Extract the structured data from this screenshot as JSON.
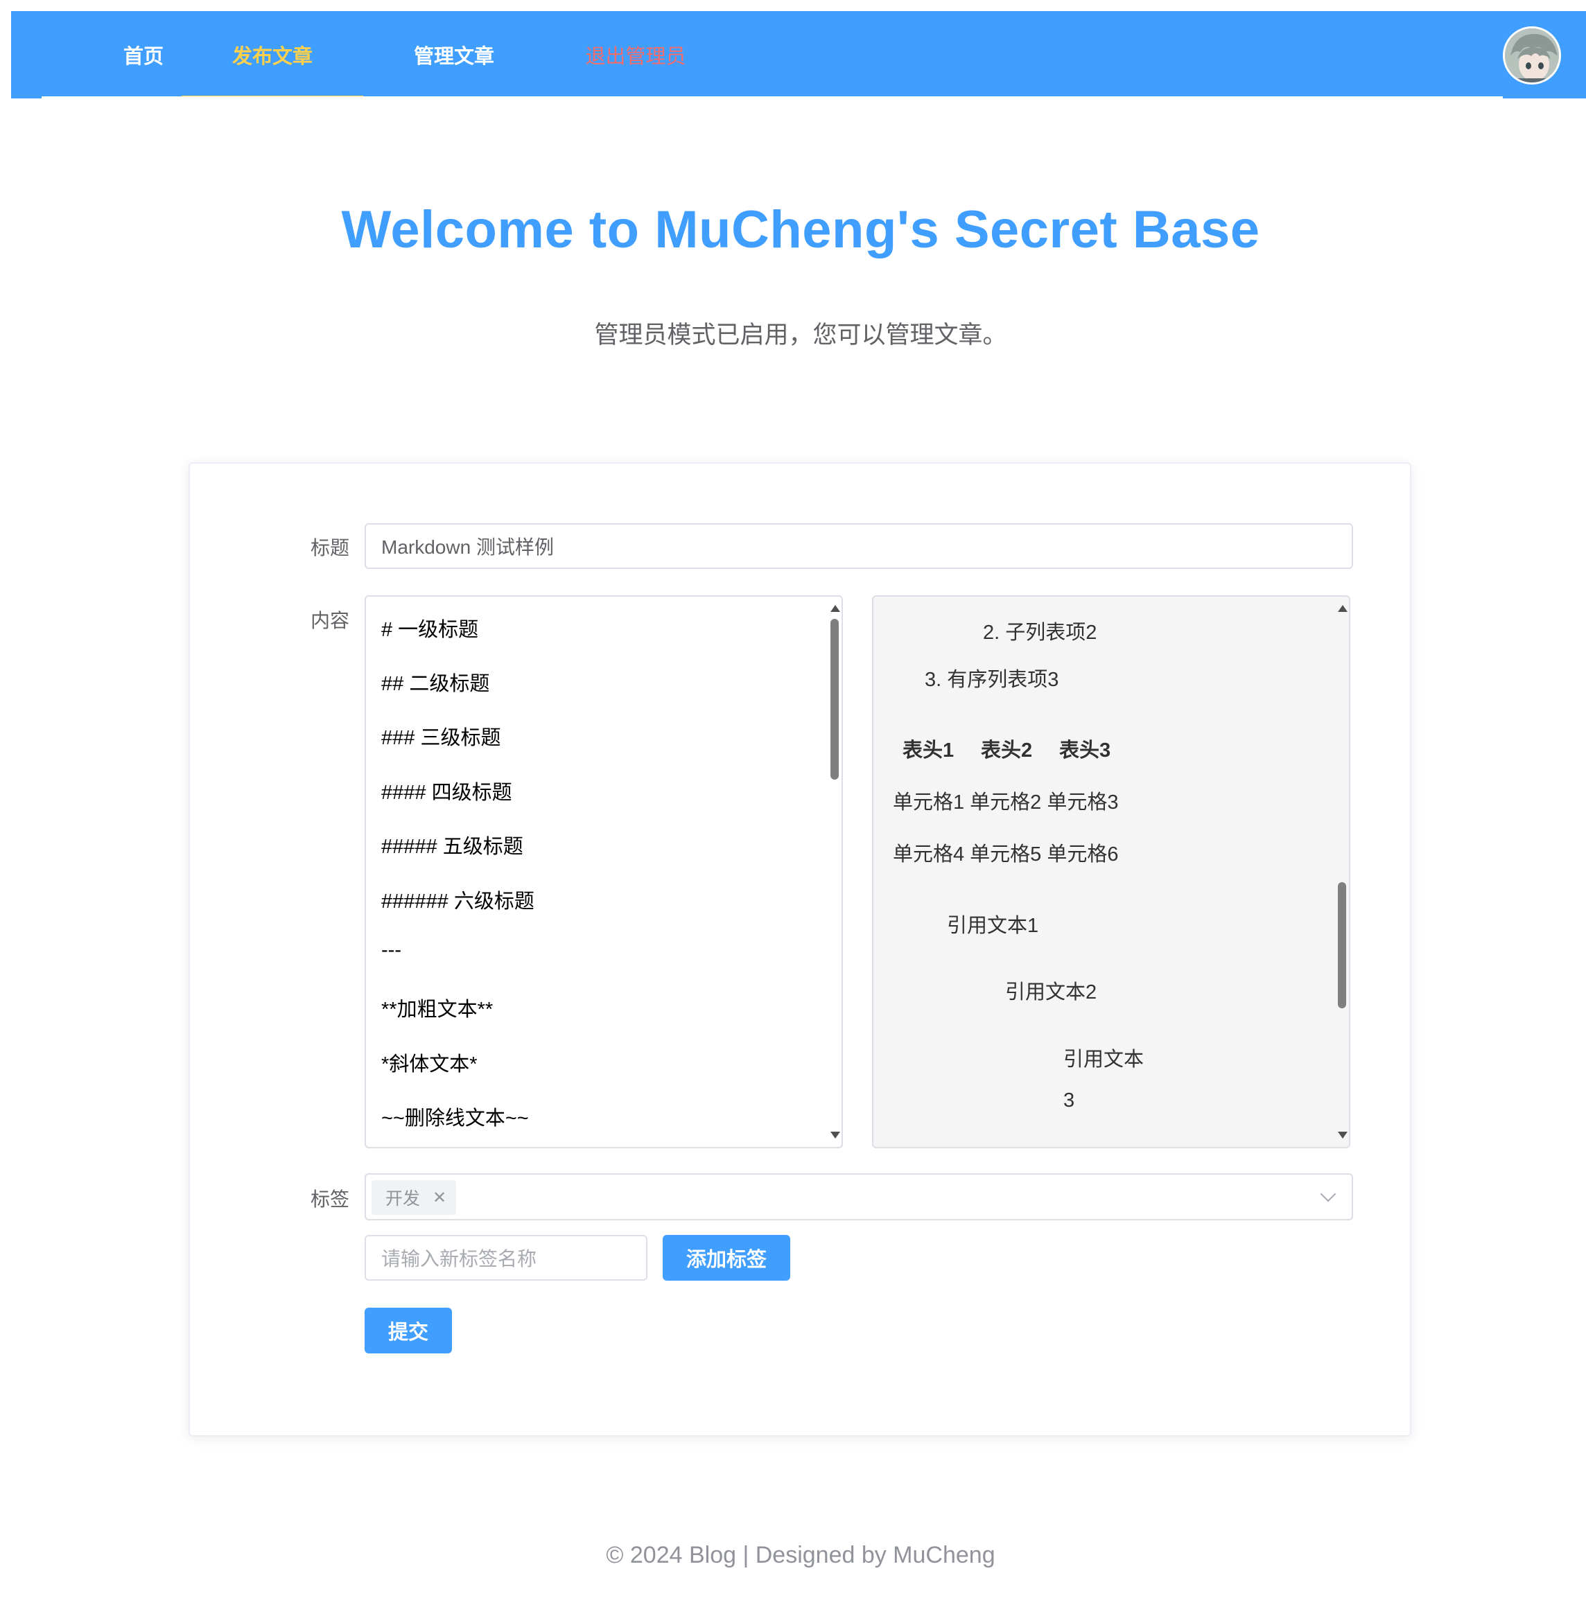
{
  "nav": {
    "items": [
      {
        "label": "首页"
      },
      {
        "label": "发布文章"
      },
      {
        "label": "管理文章"
      },
      {
        "label": "退出管理员"
      }
    ],
    "active_color": "#ffd04b",
    "logout_color": "#f56c6c",
    "background": "#409eff"
  },
  "hero": {
    "title": "Welcome to MuCheng's Secret Base",
    "subtitle": "管理员模式已启用，您可以管理文章。"
  },
  "form": {
    "title_label": "标题",
    "title_value": "Markdown 测试样例",
    "content_label": "内容",
    "editor_lines": [
      "# 一级标题",
      "## 二级标题",
      "### 三级标题",
      "#### 四级标题",
      "##### 五级标题",
      "###### 六级标题",
      "---",
      "**加粗文本**",
      "*斜体文本*",
      "~~删除线文本~~"
    ],
    "preview": {
      "list_items": [
        "2. 子列表项2",
        "3. 有序列表项3"
      ],
      "table_headers": [
        "表头1",
        "表头2",
        "表头3"
      ],
      "table_rows": [
        "单元格1 单元格2 单元格3",
        "单元格4 单元格5 单元格6"
      ],
      "quotes": [
        "引用文本1",
        "引用文本2",
        "引用文本",
        "3"
      ]
    },
    "tags_label": "标签",
    "selected_tag": "开发",
    "new_tag_placeholder": "请输入新标签名称",
    "add_tag_button": "添加标签",
    "submit_button": "提交"
  },
  "footer": {
    "text": "© 2024 Blog | Designed by MuCheng"
  }
}
